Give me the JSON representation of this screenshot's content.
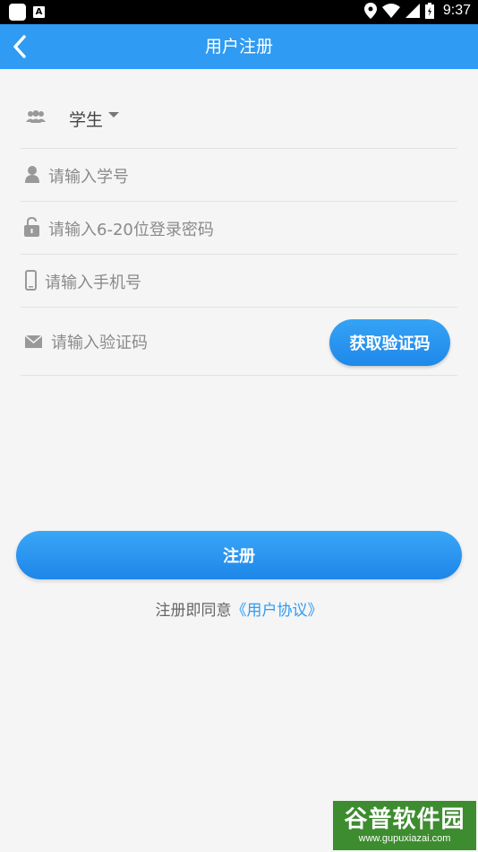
{
  "status_bar": {
    "time": "9:37",
    "icons": [
      "app-icon",
      "a-badge-icon",
      "location-icon",
      "wifi-icon",
      "signal-icon",
      "battery-icon"
    ]
  },
  "header": {
    "back_icon": "chevron-left-icon",
    "title": "用户注册",
    "background": "#2f9bf2"
  },
  "form": {
    "role": {
      "icon": "users-icon",
      "selected": "学生"
    },
    "student_id": {
      "icon": "person-icon",
      "placeholder": "请输入学号"
    },
    "password": {
      "icon": "lock-icon",
      "placeholder": "请输入6-20位登录密码"
    },
    "phone": {
      "icon": "phone-icon",
      "placeholder": "请输入手机号"
    },
    "verification": {
      "icon": "mail-icon",
      "placeholder": "请输入验证码",
      "button_label": "获取验证码"
    }
  },
  "submit": {
    "label": "注册"
  },
  "agreement": {
    "prefix": "注册即同意",
    "link": "《用户协议》"
  },
  "watermark": {
    "logo": "谷普软件园",
    "url": "www.gupuxiazai.com"
  },
  "colors": {
    "accent": "#2f9bf2",
    "background": "#f5f5f5",
    "placeholder": "#8a8a8a",
    "watermark": "#3d8c2f"
  }
}
